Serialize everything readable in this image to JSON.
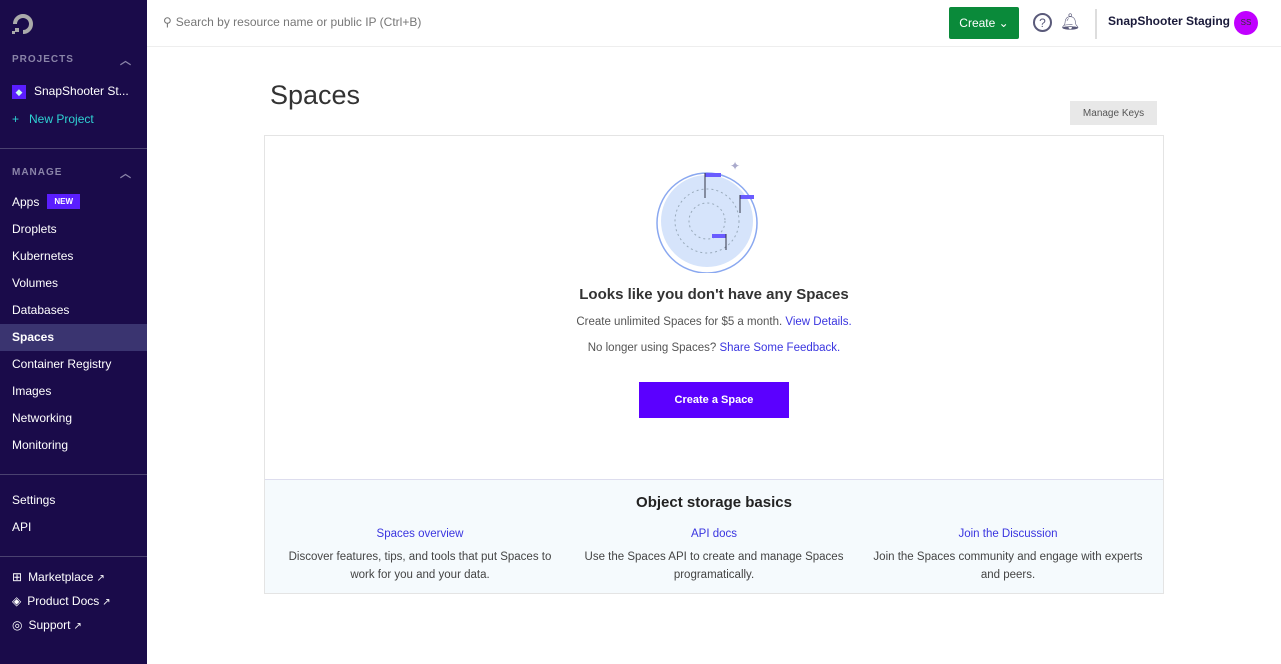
{
  "sidebar": {
    "projects_label": "PROJECTS",
    "project": "SnapShooter St...",
    "new_project": "New Project",
    "manage_label": "MANAGE",
    "apps": "Apps",
    "new_badge": "NEW",
    "items": [
      "Droplets",
      "Kubernetes",
      "Volumes",
      "Databases",
      "Spaces",
      "Container Registry",
      "Images",
      "Networking",
      "Monitoring"
    ],
    "settings": "Settings",
    "api": "API",
    "marketplace": "Marketplace",
    "product_docs": "Product Docs",
    "support": "Support"
  },
  "topbar": {
    "search_placeholder": "Search by resource name or public IP (Ctrl+B)",
    "create": "Create",
    "team": "SnapShooter Staging",
    "avatar_initials": "SS"
  },
  "page": {
    "title": "Spaces",
    "manage_keys": "Manage Keys",
    "empty_title": "Looks like you don't have any Spaces",
    "line1": "Create unlimited Spaces for $5 a month.",
    "line1_link": "View Details.",
    "line2": "No longer using Spaces?",
    "line2_link": "Share Some Feedback.",
    "create_button": "Create a Space"
  },
  "basics": {
    "title": "Object storage basics",
    "cols": [
      {
        "link": "Spaces overview",
        "text": "Discover features, tips, and tools that put Spaces to work for you and your data."
      },
      {
        "link": "API docs",
        "text": "Use the Spaces API to create and manage Spaces programatically."
      },
      {
        "link": "Join the Discussion",
        "text": "Join the Spaces community and engage with experts and peers."
      }
    ]
  }
}
